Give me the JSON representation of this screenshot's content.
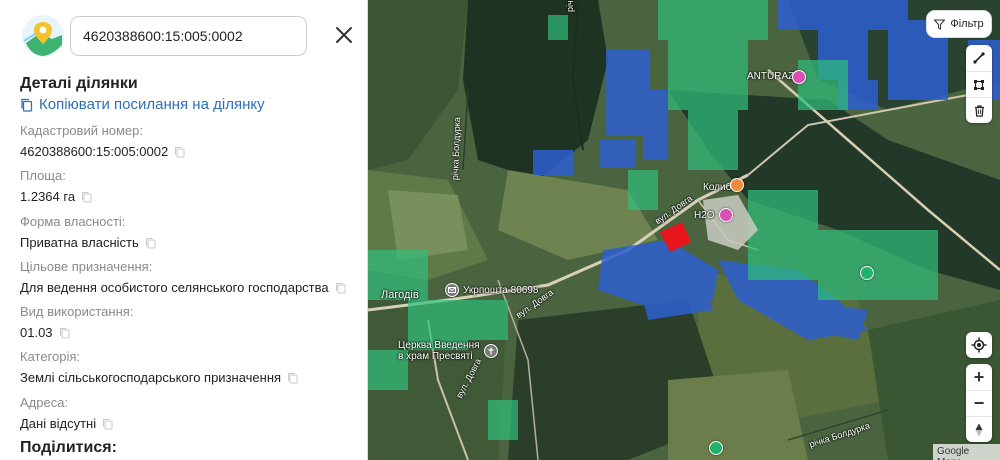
{
  "search": {
    "value": "4620388600:15:005:0002",
    "placeholder": ""
  },
  "panel": {
    "title": "Деталі ділянки",
    "copy_link_label": "Копіювати посилання на ділянку",
    "fields": [
      {
        "label": "Кадастровий номер:",
        "value": "4620388600:15:005:0002"
      },
      {
        "label": "Площа:",
        "value": "1.2364 га"
      },
      {
        "label": "Форма власності:",
        "value": "Приватна власність"
      },
      {
        "label": "Цільове призначення:",
        "value": "Для ведення особистого селянського господарства"
      },
      {
        "label": "Вид використання:",
        "value": "01.03"
      },
      {
        "label": "Категорія:",
        "value": "Землі сільськогосподарського призначення"
      },
      {
        "label": "Адреса:",
        "value": "Дані відсутні"
      }
    ],
    "share_title": "Поділитися:"
  },
  "map": {
    "filter_label": "Фільтр",
    "labels": {
      "anturazh": "ANTURAZH",
      "kolyba": "Колиба",
      "h2o": "H2O",
      "ukrposhta": "Укрпошта 80698",
      "lahodiv": "Лагодів",
      "church": "Церква Введення",
      "church2": "в храм Пресвяті",
      "river_top": "річка Болдурка",
      "river_left": "річка Болдурка",
      "river_bottom": "річка Болдурка",
      "street1": "вул. Довга",
      "street2": "вул. Довга",
      "street3": "вул. Довга"
    },
    "attribution": "Google Maps",
    "zoom_in": "+",
    "zoom_out": "−"
  },
  "colors": {
    "accent_link": "#2f6fb6",
    "selected_parcel": "#e8161b",
    "parcel_blue": "#2d5fd0",
    "parcel_green": "#2fbf7a"
  }
}
